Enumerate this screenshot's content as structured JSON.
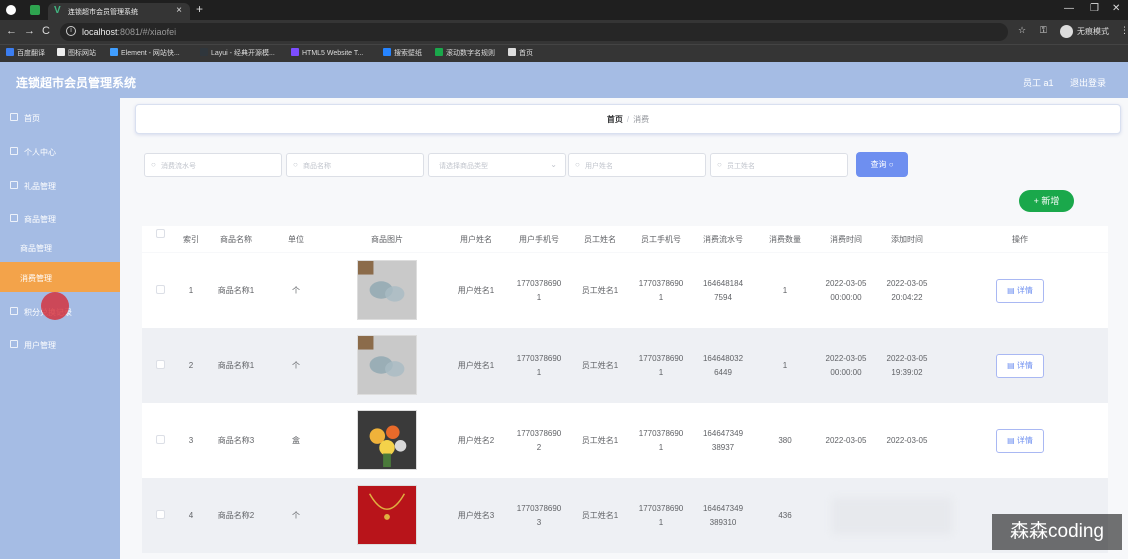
{
  "browser": {
    "tab_title": "连锁超市会员管理系统",
    "url_host": "localhost",
    "url_path": ":8081/#/xiaofei",
    "profile_label": "无痕模式",
    "bookmarks": [
      {
        "label": "百度翻译",
        "color": "#3b7df0"
      },
      {
        "label": "图标网站",
        "color": "#eeeeee"
      },
      {
        "label": "Element - 网站快...",
        "color": "#409eff"
      },
      {
        "label": "Layui - 经典开源模...",
        "color": "#2f363c"
      },
      {
        "label": "HTML5 Website T...",
        "color": "#7c4dff"
      },
      {
        "label": "搜索壁纸",
        "color": "#2684ff"
      },
      {
        "label": "滚动数字名规则",
        "color": "#1aa84b"
      },
      {
        "label": "首页",
        "color": "#dddddd"
      }
    ]
  },
  "app": {
    "title": "连锁超市会员管理系统",
    "user": "员工 a1",
    "logout": "退出登录"
  },
  "sidebar": {
    "items": [
      {
        "label": "首页"
      },
      {
        "label": "个人中心"
      },
      {
        "label": "礼品管理"
      },
      {
        "label": "商品管理"
      }
    ],
    "sub_items": [
      {
        "label": "商品管理"
      },
      {
        "label": "消费管理"
      }
    ],
    "items_after": [
      {
        "label": "积分兑换记录"
      },
      {
        "label": "用户管理"
      }
    ]
  },
  "breadcrumb": {
    "home": "首页",
    "separator": "/",
    "current": "消费"
  },
  "search": {
    "flow_no": "消费流水号",
    "product_name": "商品名称",
    "category": "请选择商品类型",
    "user_name": "用户姓名",
    "staff_name": "员工姓名",
    "button": "查询"
  },
  "add_button": "+ 新增",
  "table": {
    "headers": [
      "索引",
      "商品名称",
      "单位",
      "商品图片",
      "用户姓名",
      "用户手机号",
      "员工姓名",
      "员工手机号",
      "消费流水号",
      "消费数量",
      "消费时间",
      "添加时间",
      "操作"
    ],
    "detail_label": "详情",
    "rows": [
      {
        "index": "1",
        "product": "商品名称1",
        "unit": "个",
        "user": "用户姓名1",
        "user_phone_a": "1770378690",
        "user_phone_b": "1",
        "staff": "员工姓名1",
        "staff_phone_a": "1770378690",
        "staff_phone_b": "1",
        "flow_a": "164648184",
        "flow_b": "7594",
        "qty": "1",
        "time_a": "2022-03-05",
        "time_b": "00:00:00",
        "added_a": "2022-03-05",
        "added_b": "20:04:22",
        "image_colors": [
          "#c9c9c9",
          "#8fa7b2"
        ]
      },
      {
        "index": "2",
        "product": "商品名称1",
        "unit": "个",
        "user": "用户姓名1",
        "user_phone_a": "1770378690",
        "user_phone_b": "1",
        "staff": "员工姓名1",
        "staff_phone_a": "1770378690",
        "staff_phone_b": "1",
        "flow_a": "164648032",
        "flow_b": "6449",
        "qty": "1",
        "time_a": "2022-03-05",
        "time_b": "00:00:00",
        "added_a": "2022-03-05",
        "added_b": "19:39:02",
        "image_colors": [
          "#c9c9c9",
          "#8fa7b2"
        ]
      },
      {
        "index": "3",
        "product": "商品名称3",
        "unit": "盒",
        "user": "用户姓名2",
        "user_phone_a": "1770378690",
        "user_phone_b": "2",
        "staff": "员工姓名1",
        "staff_phone_a": "1770378690",
        "staff_phone_b": "1",
        "flow_a": "164647349",
        "flow_b": "38937",
        "qty": "380",
        "time_a": "2022-03-05",
        "time_b": "",
        "added_a": "2022-03-05",
        "added_b": "",
        "image_colors": [
          "#3a3a3a",
          "#f0b23a"
        ]
      },
      {
        "index": "4",
        "product": "商品名称2",
        "unit": "个",
        "user": "用户姓名3",
        "user_phone_a": "1770378690",
        "user_phone_b": "3",
        "staff": "员工姓名1",
        "staff_phone_a": "1770378690",
        "staff_phone_b": "1",
        "flow_a": "164647349",
        "flow_b": "389310",
        "qty": "436",
        "time_a": "",
        "time_b": "",
        "added_a": "",
        "added_b": "",
        "image_colors": [
          "#b8141a",
          "#e0b040"
        ]
      }
    ]
  },
  "watermark": "森森coding"
}
